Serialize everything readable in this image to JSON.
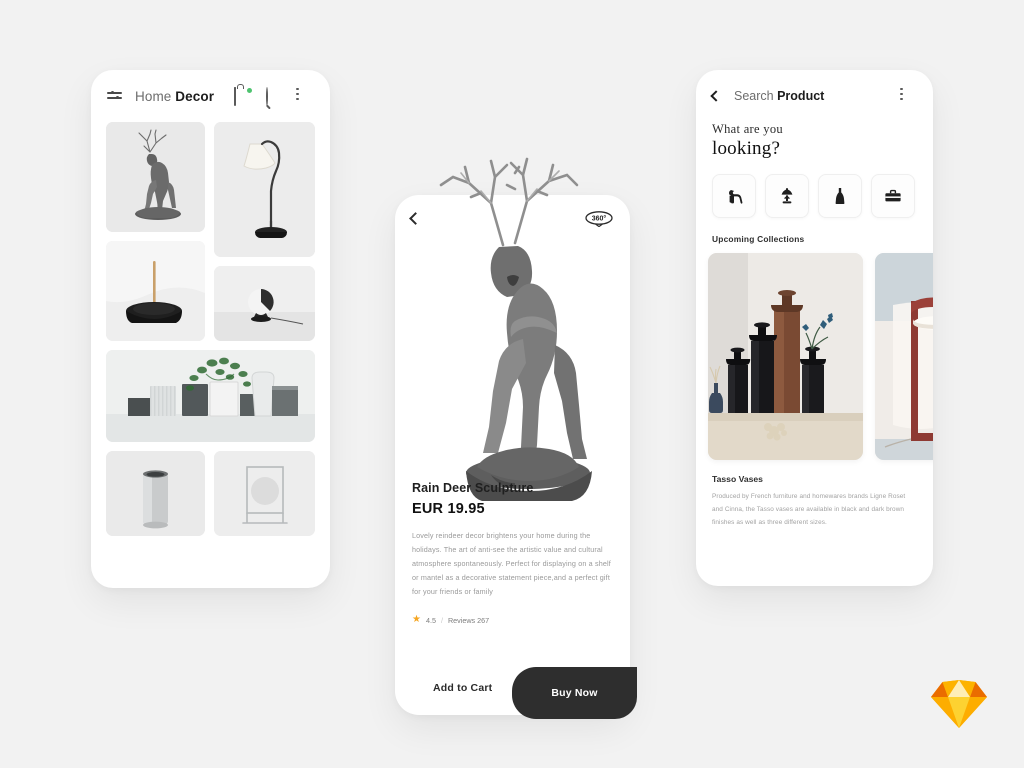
{
  "background_color": "#f2f2f2",
  "panels": {
    "home": {
      "menu_icon": "filter-menu-icon",
      "title_light": "Home",
      "title_bold": "Decor",
      "actions": [
        {
          "icon": "shopping-bag-icon",
          "badge": true,
          "badge_color": "#4ec36f"
        },
        {
          "icon": "search-icon"
        },
        {
          "icon": "more-vertical-icon"
        }
      ],
      "grid": [
        {
          "name": "deer-sculpture",
          "span": "tall-left"
        },
        {
          "name": "floor-lamp",
          "span": "tall-right"
        },
        {
          "name": "incense-holder",
          "span": "left"
        },
        {
          "name": "orb-lamp",
          "span": "small-right"
        },
        {
          "name": "planters-collection",
          "span": "full-wide"
        },
        {
          "name": "metal-vase",
          "span": "left"
        },
        {
          "name": "framed-circle-stand",
          "span": "right"
        }
      ]
    },
    "product": {
      "back_icon": "chevron-left-icon",
      "badge_360": "360°",
      "image": "rain-deer-sculpture",
      "name": "Rain Deer Sculpture",
      "price": "EUR 19.95",
      "description": "Lovely reindeer decor brightens your home during the holidays. The art of anti-see the artistic value and cultural atmosphere spontaneously. Perfect for displaying on a shelf or mantel as a decorative statement piece,and a perfect gift for your friends or family",
      "rating_value": "4.5",
      "rating_separator": "/",
      "reviews_label": "Reviews 267",
      "star_color": "#f5a623",
      "add_to_cart_label": "Add to Cart",
      "buy_now_label": "Buy Now",
      "buy_now_color": "#2e2e2e"
    },
    "search": {
      "back_icon": "chevron-left-icon",
      "title_light": "Search",
      "title_bold": "Product",
      "menu_icon": "more-vertical-icon",
      "prompt_line1": "What are you",
      "prompt_line2": "looking?",
      "categories": [
        {
          "name": "animal-figurine-icon"
        },
        {
          "name": "table-lamp-icon"
        },
        {
          "name": "vase-icon"
        },
        {
          "name": "storage-box-icon"
        }
      ],
      "upcoming_label": "Upcoming Collections",
      "collections": [
        {
          "name": "tasso-vases-image"
        },
        {
          "name": "red-table-lamp-image"
        }
      ],
      "collection_title": "Tasso Vases",
      "collection_description": "Produced by French furniture and homewares brands Ligne Roset and Cinna, the Tasso vases are available in black and dark brown finishes as well as three different sizes."
    }
  },
  "watermark": {
    "name": "sketch-logo",
    "colors": [
      "#fdb300",
      "#ea6c00",
      "#fdad00",
      "#feeeb7"
    ]
  }
}
